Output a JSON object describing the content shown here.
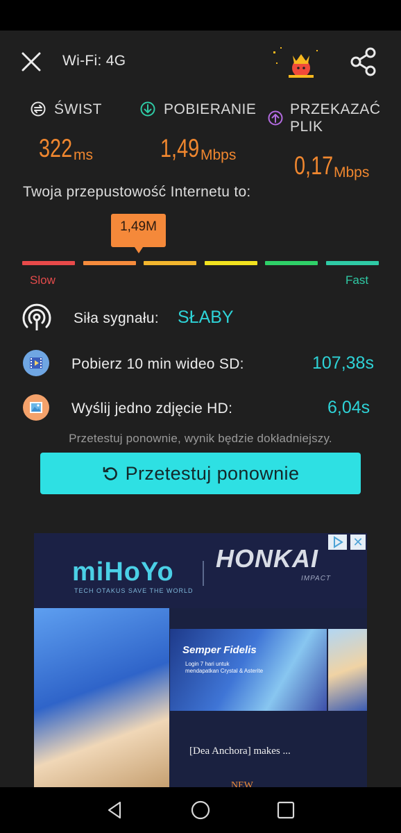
{
  "header": {
    "title": "Wi-Fi: 4G"
  },
  "metrics": {
    "ping": {
      "label": "ŚWIST",
      "value": "322",
      "unit": "ms",
      "icon": "ping-icon"
    },
    "download": {
      "label": "POBIERANIE",
      "value": "1,49",
      "unit": "Mbps",
      "icon": "download-arrow-icon"
    },
    "upload": {
      "label_line1": "PRZEKAZAĆ",
      "label_line2": "PLIK",
      "value": "0,17",
      "unit": "Mbps",
      "icon": "upload-arrow-icon"
    }
  },
  "bandwidth": {
    "label": "Twoja przepustowość Internetu to:",
    "marker": "1,49M",
    "scale_slow": "Slow",
    "scale_fast": "Fast",
    "segment_colors": [
      "#e84a4a",
      "#f58b3c",
      "#f2b62e",
      "#f1e21f",
      "#2fd068",
      "#2fcaa5"
    ]
  },
  "signal": {
    "label": "Siła sygnału:",
    "value": "SŁABY"
  },
  "video": {
    "label": "Pobierz 10 min wideo SD:",
    "value": "107,38s"
  },
  "photo": {
    "label": "Wyślij jedno zdjęcie HD:",
    "value": "6,04s"
  },
  "hint": "Przetestuj ponownie, wynik będzie dokładniejszy.",
  "retest_button": "Przetestuj ponownie",
  "ad": {
    "brand": "miHoYo",
    "tagline": "TECH OTAKUS SAVE THE WORLD",
    "game": "HONKAI",
    "game_sub": "IMPACT",
    "mid_title": "Semper Fidelis",
    "mid_text_1": "Login 7 hari untuk",
    "mid_text_2": "mendapatkan Crystal & Asterite",
    "headline": "[Dea Anchora] makes ...",
    "cta": "NEW"
  },
  "colors": {
    "accent": "#2ee0e3",
    "orange": "#f0872f",
    "background": "#1f1f1f"
  }
}
